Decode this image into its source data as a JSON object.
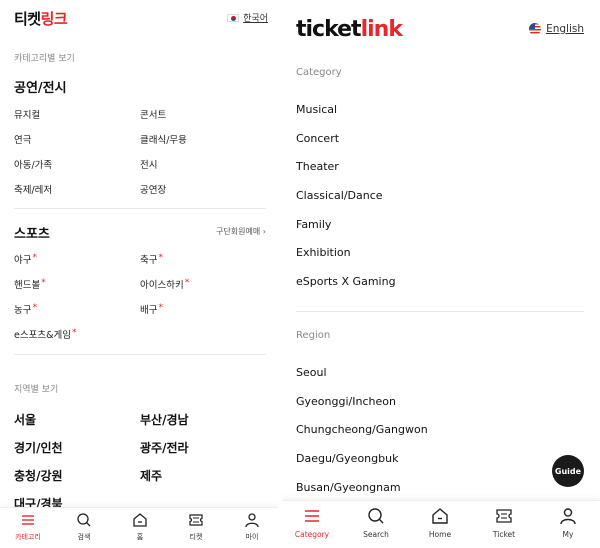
{
  "colors": {
    "accent": "#e8262b",
    "text": "#111111",
    "muted": "#888888",
    "divider": "#e8e8e8"
  },
  "korean": {
    "logo_dark": "티켓",
    "logo_red": "링크",
    "lang_label": "한국어",
    "lang_icon": "korea-flag-icon",
    "category_section": "카테고리별 보기",
    "performance_title": "공연/전시",
    "performance_items": [
      "뮤지컬",
      "콘서트",
      "연극",
      "클래식/무용",
      "아동/가족",
      "전시",
      "축제/레저",
      "공연장"
    ],
    "sports_title": "스포츠",
    "sports_link": "구단회원예매",
    "sports_items": [
      "야구",
      "축구",
      "핸드볼",
      "아이스하키",
      "농구",
      "배구",
      "e스포츠&게임"
    ],
    "new_marker": "*",
    "region_section": "지역별 보기",
    "regions": [
      "서울",
      "부산/경남",
      "경기/인천",
      "광주/전라",
      "충청/강원",
      "제주",
      "대구/경북"
    ],
    "tabs": [
      {
        "label": "카테고리",
        "icon": "menu-icon"
      },
      {
        "label": "검색",
        "icon": "search-icon"
      },
      {
        "label": "홈",
        "icon": "home-icon"
      },
      {
        "label": "티켓",
        "icon": "ticket-icon"
      },
      {
        "label": "마이",
        "icon": "user-icon"
      }
    ]
  },
  "english": {
    "logo_dark": "ticket",
    "logo_red": "link",
    "lang_label": "English",
    "lang_icon": "us-flag-icon",
    "category_section": "Category",
    "categories": [
      "Musical",
      "Concert",
      "Theater",
      "Classical/Dance",
      "Family",
      "Exhibition",
      "eSports X Gaming"
    ],
    "region_section": "Region",
    "regions": [
      "Seoul",
      "Gyeonggi/Incheon",
      "Chungcheong/Gangwon",
      "Daegu/Gyeongbuk",
      "Busan/Gyeongnam"
    ],
    "guide_label": "Guide",
    "tabs": [
      {
        "label": "Category",
        "icon": "menu-icon"
      },
      {
        "label": "Search",
        "icon": "search-icon"
      },
      {
        "label": "Home",
        "icon": "home-icon"
      },
      {
        "label": "Ticket",
        "icon": "ticket-icon"
      },
      {
        "label": "My",
        "icon": "user-icon"
      }
    ]
  }
}
